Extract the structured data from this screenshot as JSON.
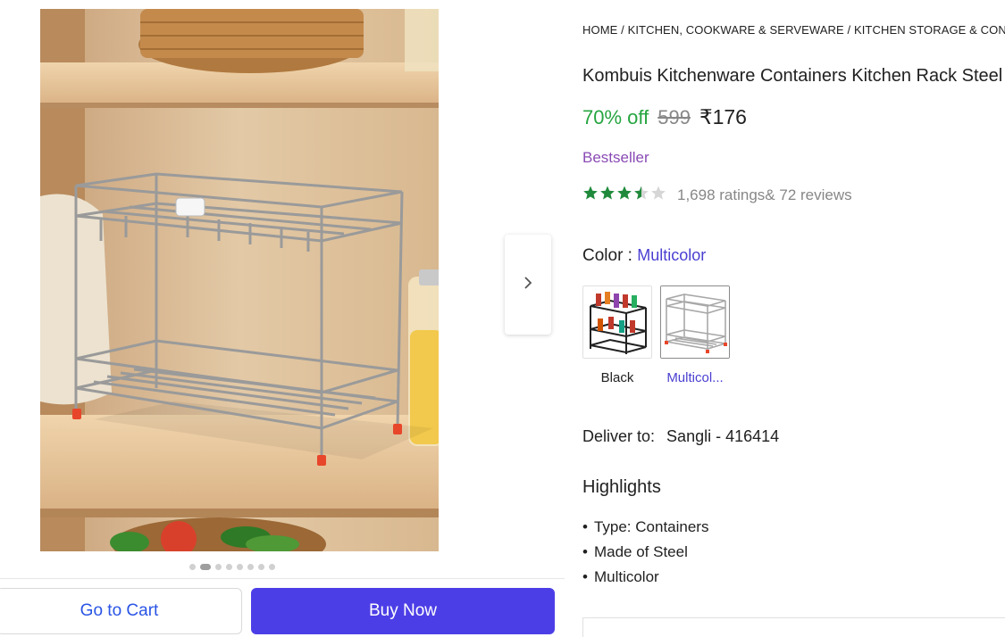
{
  "gallery": {
    "image_alt": "Two-tier steel kitchen rack on a wooden shelf",
    "next_icon": "chevron-right-icon",
    "dots_total": 8,
    "dots_active_index": 1
  },
  "actions": {
    "cart_label": "Go to Cart",
    "buy_label": "Buy Now"
  },
  "breadcrumb": [
    "HOME",
    "KITCHEN, COOKWARE & SERVEWARE",
    "KITCHEN STORAGE & CONTAINERS"
  ],
  "product": {
    "title": "Kombuis Kitchenware Containers Kitchen Rack Steel",
    "discount": "70% off",
    "mrp": "599",
    "price": "₹176",
    "badge": "Bestseller",
    "rating_stars": 3.5,
    "ratings_text": "1,698 ratings",
    "reviews_text": "& 72 reviews"
  },
  "color": {
    "label": "Color :",
    "value": "Multicolor",
    "options": [
      {
        "label": "Black",
        "selected": false
      },
      {
        "label": "Multicol...",
        "selected": true
      }
    ]
  },
  "delivery": {
    "label": "Deliver to:",
    "pincode": "Sangli - 416414"
  },
  "highlights": {
    "title": "Highlights",
    "items": [
      "Type: Containers",
      "Made of Steel",
      "Multicolor"
    ]
  },
  "colors": {
    "accent": "#4c3ee6",
    "discount_green": "#26a541",
    "bestseller_purple": "#8a4bb5",
    "star_green": "#1f8a3b"
  }
}
